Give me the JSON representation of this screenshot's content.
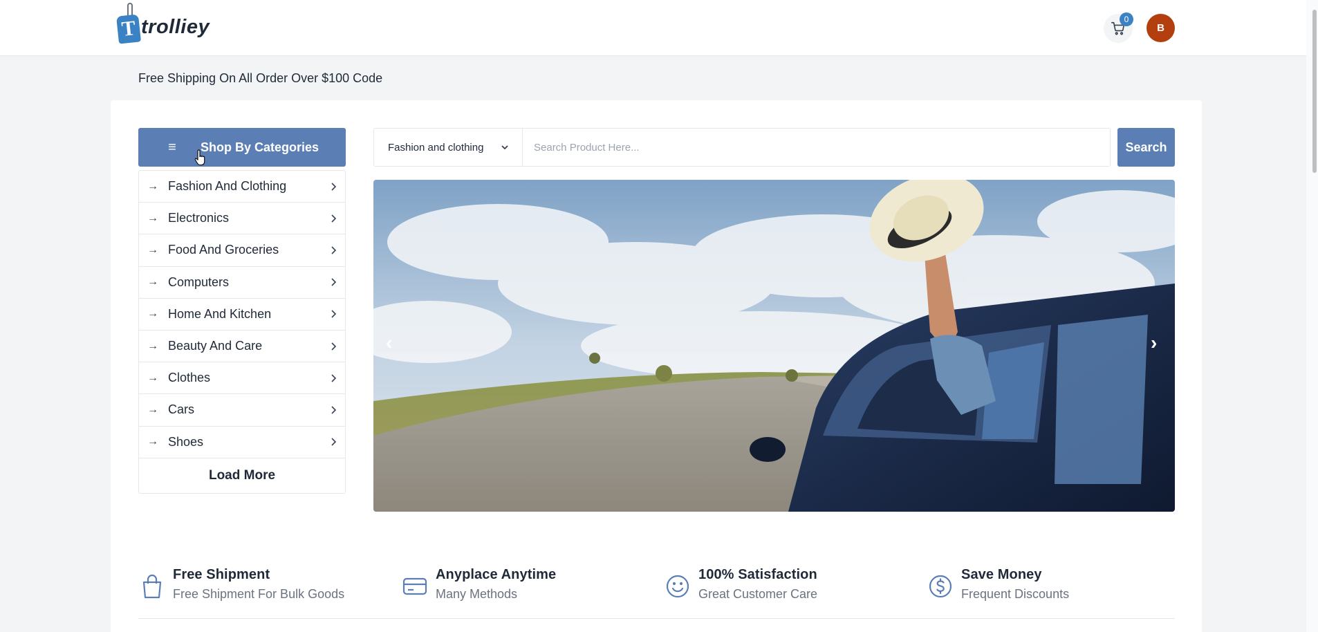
{
  "header": {
    "logo_letter": "T",
    "logo_text": "trolliey",
    "cart_count": "0",
    "avatar_initial": "B"
  },
  "promo_text": "Free Shipping On All Order Over $100 Code",
  "categories": {
    "button_label": "Shop By Categories",
    "items": [
      {
        "label": "Fashion And Clothing"
      },
      {
        "label": "Electronics"
      },
      {
        "label": "Food And Groceries"
      },
      {
        "label": "Computers"
      },
      {
        "label": "Home And Kitchen"
      },
      {
        "label": "Beauty And Care"
      },
      {
        "label": "Clothes"
      },
      {
        "label": "Cars"
      },
      {
        "label": "Shoes"
      }
    ],
    "load_more": "Load More"
  },
  "search": {
    "selected_category": "Fashion and clothing",
    "placeholder": "Search Product Here...",
    "button_label": "Search"
  },
  "carousel": {
    "prev": "‹",
    "next": "›"
  },
  "features": [
    {
      "icon": "shopping-bag-icon",
      "title": "Free Shipment",
      "subtitle": "Free Shipment For Bulk Goods"
    },
    {
      "icon": "credit-card-icon",
      "title": "Anyplace Anytime",
      "subtitle": "Many Methods"
    },
    {
      "icon": "smiley-icon",
      "title": "100% Satisfaction",
      "subtitle": "Great Customer Care"
    },
    {
      "icon": "dollar-icon",
      "title": "Save Money",
      "subtitle": "Frequent Discounts"
    }
  ],
  "colors": {
    "accent": "#5b7fb5",
    "avatar": "#b43f0e",
    "icon_blue": "#3b82c4"
  }
}
